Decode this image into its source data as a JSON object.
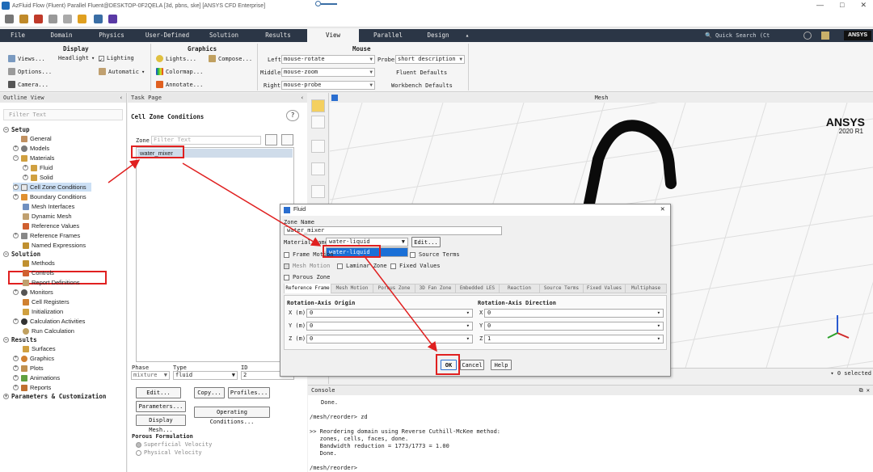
{
  "window": {
    "title": "AzFluid Flow (Fluent) Parallel Fluent@DESKTOP-0F2QELA [3d, pbns, ske] [ANSYS CFD Enterprise]",
    "controls": [
      "—",
      "□",
      "✕"
    ]
  },
  "ribbon_tabs": [
    "File",
    "Domain",
    "Physics",
    "User-Defined",
    "Solution",
    "Results",
    "View",
    "Parallel",
    "Design"
  ],
  "active_tab": "View",
  "search_placeholder": "Quick Search (Ct",
  "brand": "ANSYS",
  "ribbon": {
    "display": {
      "header": "Display",
      "views": "Views...",
      "headlight": "Headlight",
      "lighting": "Lighting",
      "options": "Options...",
      "automatic": "Automatic",
      "camera": "Camera..."
    },
    "graphics": {
      "header": "Graphics",
      "lights": "Lights...",
      "compose": "Compose...",
      "colormap": "Colormap...",
      "annotate": "Annotate..."
    },
    "mouse": {
      "header": "Mouse",
      "left_label": "Left",
      "left_value": "mouse-rotate",
      "middle_label": "Middle",
      "middle_value": "mouse-zoom",
      "right_label": "Right",
      "right_value": "mouse-probe",
      "probe_label": "Probe",
      "probe_value": "short description",
      "fluent_defaults": "Fluent Defaults",
      "workbench_defaults": "Workbench Defaults"
    }
  },
  "outline": {
    "header": "Outline View",
    "filter_placeholder": "Filter Text",
    "sections": [
      {
        "label": "Setup"
      },
      {
        "label": "Solution"
      },
      {
        "label": "Results"
      },
      {
        "label": "Parameters & Customization"
      }
    ],
    "setup_items": [
      "General",
      "Models",
      "Materials",
      "Fluid",
      "Solid",
      "Cell Zone Conditions",
      "Boundary Conditions",
      "Mesh Interfaces",
      "Dynamic Mesh",
      "Reference Values",
      "Reference Frames",
      "Named Expressions"
    ],
    "solution_items": [
      "Methods",
      "Controls",
      "Report Definitions",
      "Monitors",
      "Cell Registers",
      "Initialization",
      "Calculation Activities",
      "Run Calculation"
    ],
    "results_items": [
      "Surfaces",
      "Graphics",
      "Plots",
      "Animations",
      "Reports"
    ]
  },
  "task_page": {
    "header": "Task Page",
    "title": "Cell Zone Conditions",
    "zone_label": "Zone",
    "zone_filter_placeholder": "Filter Text",
    "zone_item": "water_mixer",
    "phase_label": "Phase",
    "phase_value": "mixture",
    "type_label": "Type",
    "type_value": "fluid",
    "id_label": "ID",
    "id_value": "2",
    "buttons": {
      "edit": "Edit...",
      "copy": "Copy...",
      "profiles": "Profiles...",
      "parameters": "Parameters...",
      "operating": "Operating Conditions...",
      "display_mesh": "Display Mesh..."
    },
    "porous_header": "Porous Formulation",
    "porous_opt1": "Superficial Velocity",
    "porous_opt2": "Physical Velocity"
  },
  "mesh_view": {
    "header": "Mesh",
    "logo_main": "ANSYS",
    "logo_version": "2020 R1",
    "selected": "0 selected"
  },
  "console": {
    "header": "Console",
    "lines": [
      "Done.",
      "",
      "/mesh/reorder> zd",
      "",
      ">> Reordering domain using Reverse Cuthill-McKee method:",
      "   zones, cells, faces, done.",
      "   Bandwidth reduction = 1773/1773 = 1.00",
      "   Done.",
      "",
      "/mesh/reorder>"
    ]
  },
  "dialog": {
    "title": "Fluid",
    "zone_name_label": "Zone Name",
    "zone_name_value": "water_mixer",
    "material_label": "Material Name",
    "material_value": "water-liquid",
    "material_option": "water-liquid",
    "edit_button": "Edit...",
    "frame_motion": "Frame Motion",
    "source_terms": "Source Terms",
    "mesh_motion": "Mesh Motion",
    "laminar_zone": "Laminar Zone",
    "fixed_values": "Fixed Values",
    "porous_zone": "Porous Zone",
    "tabs": [
      "Reference Frame",
      "Mesh Motion",
      "Porous Zone",
      "3D Fan Zone",
      "Embedded LES",
      "Reaction",
      "Source Terms",
      "Fixed Values",
      "Multiphase"
    ],
    "origin_header": "Rotation-Axis Origin",
    "direction_header": "Rotation-Axis Direction",
    "origin": [
      {
        "axis": "X (m)",
        "value": "0"
      },
      {
        "axis": "Y (m)",
        "value": "0"
      },
      {
        "axis": "Z (m)",
        "value": "0"
      }
    ],
    "direction": [
      {
        "axis": "X",
        "value": "0"
      },
      {
        "axis": "Y",
        "value": "0"
      },
      {
        "axis": "Z",
        "value": "1"
      }
    ],
    "ok": "OK",
    "cancel": "Cancel",
    "help": "Help"
  },
  "colors": {
    "ribbon_dark": "#2b3646",
    "annotation_red": "#e02020",
    "selection_blue": "#1a6fd6"
  }
}
